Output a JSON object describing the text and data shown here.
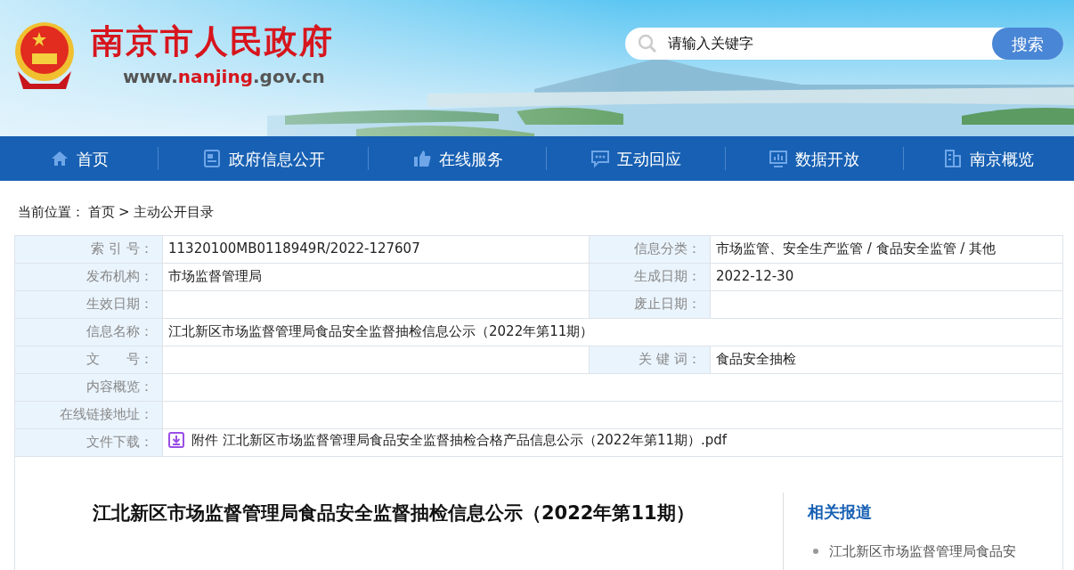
{
  "header": {
    "title": "南京市人民政府",
    "url": {
      "prefix": "www.",
      "domain": "nanjing",
      "suffix": ".gov.cn"
    },
    "search": {
      "placeholder": "请输入关键字",
      "button": "搜索"
    }
  },
  "nav": [
    {
      "label": "首页"
    },
    {
      "label": "政府信息公开"
    },
    {
      "label": "在线服务"
    },
    {
      "label": "互动回应"
    },
    {
      "label": "数据开放"
    },
    {
      "label": "南京概览"
    }
  ],
  "breadcrumb": {
    "prefix": "当前位置：",
    "items": [
      "首页",
      "主动公开目录"
    ],
    "separator": ">"
  },
  "meta": [
    {
      "fields": [
        {
          "label": "索 引 号：",
          "value": "11320100MB0118949R/2022-127607"
        },
        {
          "label": "信息分类：",
          "value": "市场监管、安全生产监管 / 食品安全监管 / 其他"
        }
      ]
    },
    {
      "fields": [
        {
          "label": "发布机构：",
          "value": "市场监督管理局"
        },
        {
          "label": "生成日期：",
          "value": "2022-12-30"
        }
      ]
    },
    {
      "fields": [
        {
          "label": "生效日期："
        },
        {
          "label": "废止日期："
        }
      ]
    },
    {
      "fields": [
        {
          "label": "信息名称：",
          "value": "江北新区市场监督管理局食品安全监督抽检信息公示（2022年第11期）"
        }
      ]
    },
    {
      "fields": [
        {
          "label": "文　　号："
        },
        {
          "label": "关 键 词：",
          "value": "食品安全抽检"
        }
      ]
    },
    {
      "fields": [
        {
          "label": "内容概览："
        }
      ]
    },
    {
      "fields": [
        {
          "label": "在线链接地址："
        }
      ]
    },
    {
      "fields": [
        {
          "label": "文件下载：",
          "attachment": "附件 江北新区市场监督管理局食品安全监督抽检合格产品信息公示（2022年第11期）.pdf"
        }
      ]
    }
  ],
  "article": {
    "title": "江北新区市场监督管理局食品安全监督抽检信息公示（2022年第11期）"
  },
  "related": {
    "heading": "相关报道",
    "items": [
      "江北新区市场监督管理局食品安"
    ]
  }
}
